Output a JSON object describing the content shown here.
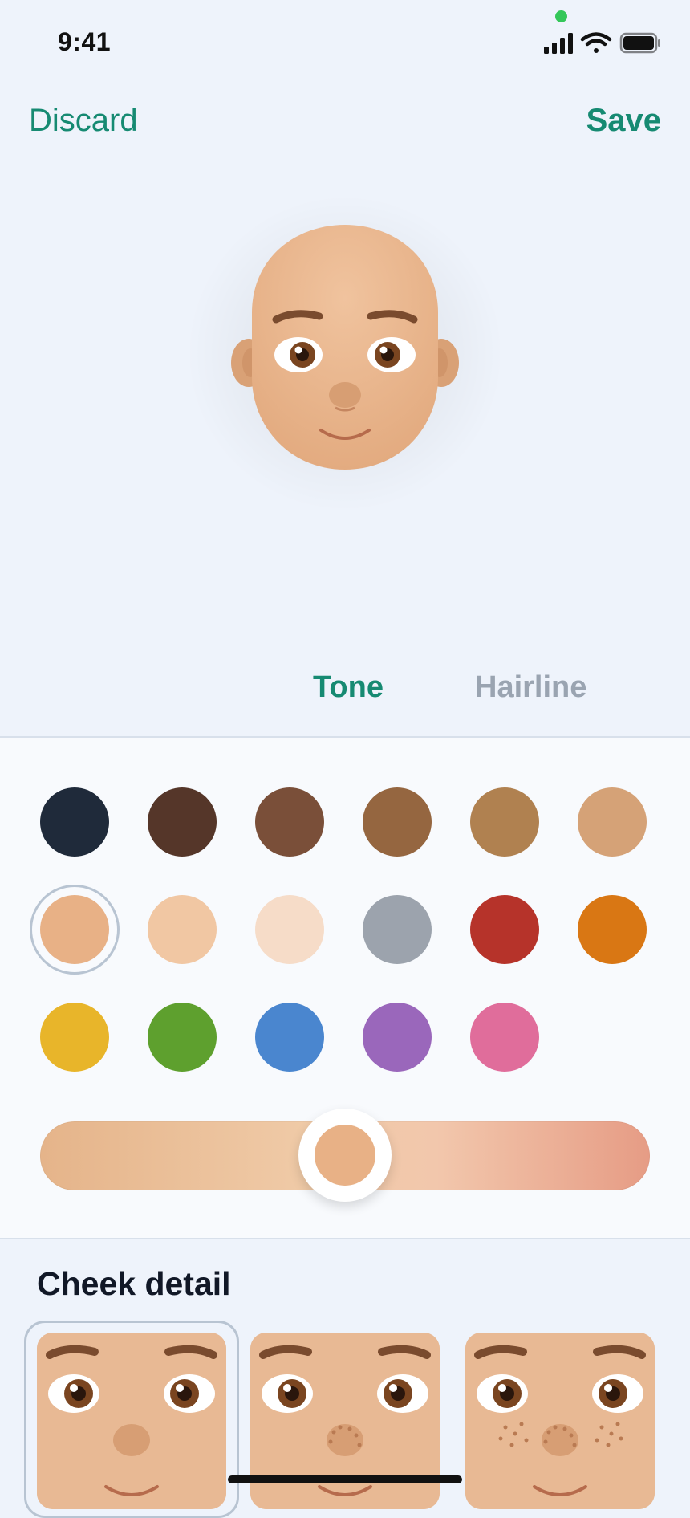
{
  "status_bar": {
    "time": "9:41",
    "icons": [
      "cellular-signal-icon",
      "wifi-icon",
      "battery-icon"
    ],
    "indicator_color": "#34c759"
  },
  "nav": {
    "discard_label": "Discard",
    "save_label": "Save",
    "accent_color": "#168a72"
  },
  "tabs": [
    {
      "label": "Tone",
      "selected": true
    },
    {
      "label": "Hairline",
      "selected": false
    }
  ],
  "tone_swatches": [
    {
      "color": "#1f2a3a"
    },
    {
      "color": "#553629"
    },
    {
      "color": "#7a4f39"
    },
    {
      "color": "#956640"
    },
    {
      "color": "#b08150"
    },
    {
      "color": "#d5a277"
    },
    {
      "color": "#e8b186",
      "selected": true
    },
    {
      "color": "#f1c7a3"
    },
    {
      "color": "#f6dcc8"
    },
    {
      "color": "#9ca3ad"
    },
    {
      "color": "#b6332a"
    },
    {
      "color": "#d97714"
    },
    {
      "color": "#e8b52a"
    },
    {
      "color": "#5ea02e"
    },
    {
      "color": "#4a86cf"
    },
    {
      "color": "#9a67bb"
    },
    {
      "color": "#e06d9b"
    }
  ],
  "tone_slider": {
    "value": 0.5,
    "knob_color": "#e8b186"
  },
  "cheek_detail": {
    "title": "Cheek detail",
    "options": [
      {
        "name": "plain",
        "selected": true
      },
      {
        "name": "light-freckles",
        "selected": false
      },
      {
        "name": "heavy-freckles",
        "selected": false
      }
    ]
  }
}
